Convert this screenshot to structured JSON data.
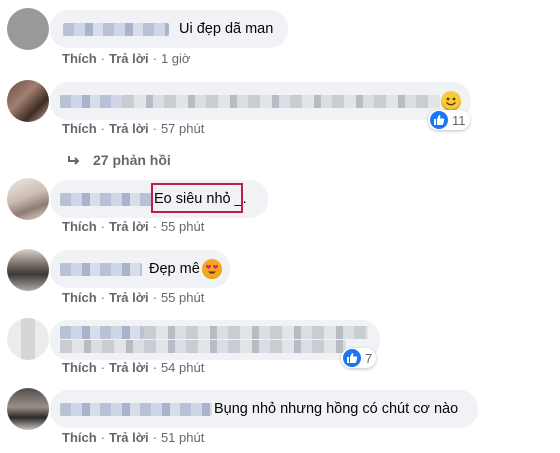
{
  "actions": {
    "like": "Thích",
    "reply": "Trả lời",
    "sep": "·"
  },
  "comments": [
    {
      "text": "Ui đẹp dã man",
      "time": "1 giờ"
    },
    {
      "text": "",
      "time": "57 phút",
      "reactions": "11"
    },
    {
      "text": "Eo siêu nhỏ _.",
      "highlight": "Eo siêu nhỏ",
      "time": "55 phút"
    },
    {
      "text": "Đẹp mê",
      "time": "55 phút"
    },
    {
      "text": "",
      "time": "54 phút",
      "reactions": "7"
    },
    {
      "text": "Bụng nhỏ nhưng hồng có chút cơ nào",
      "time": "51 phút"
    }
  ],
  "replies": {
    "label": "27 phản hồi"
  },
  "colors": {
    "bubble": "#f0f2f5",
    "meta": "#65676b",
    "like": "#1877f2",
    "highlight": "#c21d4a"
  }
}
